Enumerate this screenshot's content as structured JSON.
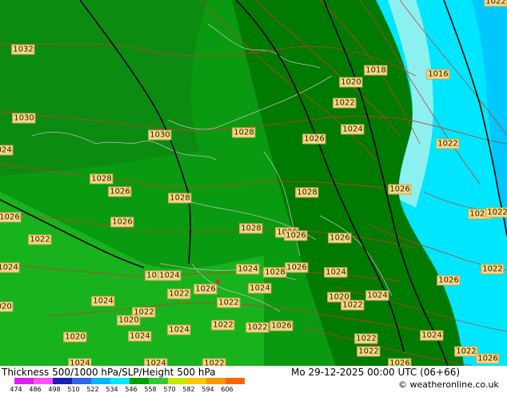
{
  "map": {
    "colors": {
      "band_546_552": "#007a00",
      "band_540_546": "#0a9a12",
      "band_534_540": "#18b21c",
      "band_528_534": "#8cf0f0",
      "band_522_528": "#00e6ff",
      "band_516_522": "#00c8ff",
      "coast_border": "#bcbcbc",
      "isobar_red": "#c83c28",
      "height_black": "#000000",
      "label_bg": "#f6d98a"
    },
    "pressure_labels": [
      {
        "id": "p1",
        "text": "1032"
      },
      {
        "id": "p2",
        "text": "1030"
      },
      {
        "id": "p3",
        "text": "1030"
      },
      {
        "id": "p4",
        "text": "1028"
      },
      {
        "id": "p5",
        "text": "1026"
      },
      {
        "id": "p6",
        "text": "1028"
      },
      {
        "id": "p7",
        "text": "1028"
      },
      {
        "id": "p8",
        "text": "1026"
      },
      {
        "id": "p9",
        "text": "1026"
      },
      {
        "id": "p10",
        "text": "1028"
      },
      {
        "id": "p11",
        "text": "1028"
      },
      {
        "id": "p12",
        "text": "1028"
      },
      {
        "id": "p13",
        "text": "1026"
      },
      {
        "id": "p14",
        "text": "1026"
      },
      {
        "id": "p15",
        "text": "1026"
      },
      {
        "id": "p16",
        "text": "1024"
      },
      {
        "id": "p17",
        "text": "1022"
      },
      {
        "id": "p18",
        "text": "1020"
      },
      {
        "id": "p19",
        "text": "1018"
      },
      {
        "id": "p20",
        "text": "1016"
      },
      {
        "id": "p21",
        "text": "1024"
      },
      {
        "id": "p22",
        "text": "1022"
      },
      {
        "id": "p23",
        "text": "1024"
      },
      {
        "id": "p24",
        "text": "1022"
      },
      {
        "id": "p25",
        "text": "1024"
      },
      {
        "id": "p26",
        "text": "1026"
      },
      {
        "id": "p27",
        "text": "1024"
      },
      {
        "id": "p28",
        "text": "1026"
      },
      {
        "id": "p29",
        "text": "1024"
      },
      {
        "id": "p30",
        "text": "1026"
      },
      {
        "id": "p31",
        "text": "1028"
      },
      {
        "id": "p32",
        "text": "1024"
      },
      {
        "id": "p33",
        "text": "1022"
      },
      {
        "id": "p34",
        "text": "1026"
      },
      {
        "id": "p35",
        "text": "1024"
      },
      {
        "id": "p36",
        "text": "1022"
      },
      {
        "id": "p37",
        "text": "1024"
      },
      {
        "id": "p38",
        "text": "1022"
      },
      {
        "id": "p39",
        "text": "1020"
      },
      {
        "id": "p40",
        "text": "1022"
      },
      {
        "id": "p41",
        "text": "1024"
      },
      {
        "id": "p42",
        "text": "1022"
      },
      {
        "id": "p43",
        "text": "1020"
      },
      {
        "id": "p44",
        "text": "1024"
      },
      {
        "id": "p45",
        "text": "1022"
      },
      {
        "id": "p46",
        "text": "1022"
      },
      {
        "id": "p47",
        "text": "1026"
      },
      {
        "id": "p48",
        "text": "1022"
      },
      {
        "id": "p49",
        "text": "1022"
      },
      {
        "id": "p50",
        "text": "1020"
      },
      {
        "id": "p51",
        "text": "1024"
      },
      {
        "id": "p52",
        "text": "1022"
      },
      {
        "id": "p53",
        "text": "1020"
      },
      {
        "id": "p54",
        "text": "1024"
      },
      {
        "id": "p55",
        "text": "1022"
      },
      {
        "id": "p56",
        "text": "1024"
      },
      {
        "id": "p57",
        "text": "1022"
      },
      {
        "id": "p58",
        "text": "1026"
      },
      {
        "id": "p59",
        "text": "1024"
      },
      {
        "id": "p60",
        "text": "1026"
      },
      {
        "id": "p61",
        "text": "1022"
      },
      {
        "id": "p62",
        "text": "1026"
      }
    ]
  },
  "footer": {
    "title": "Thickness 500/1000 hPa/SLP/Height 500 hPa",
    "datetime": "Mo 29-12-2025 00:00 UTC (06+66)",
    "credit": "© weatheronline.co.uk",
    "scale": [
      {
        "label": "474",
        "color": "#e01ef0"
      },
      {
        "label": "486",
        "color": "#ff50ff"
      },
      {
        "label": "498",
        "color": "#1e1eb4"
      },
      {
        "label": "510",
        "color": "#3264e6"
      },
      {
        "label": "522",
        "color": "#00b4ff"
      },
      {
        "label": "534",
        "color": "#00e6ff"
      },
      {
        "label": "546",
        "color": "#00a000"
      },
      {
        "label": "558",
        "color": "#32c832"
      },
      {
        "label": "570",
        "color": "#c8e600"
      },
      {
        "label": "582",
        "color": "#ffc800"
      },
      {
        "label": "594",
        "color": "#ff9600"
      },
      {
        "label": "606",
        "color": "#ff6400"
      }
    ]
  }
}
